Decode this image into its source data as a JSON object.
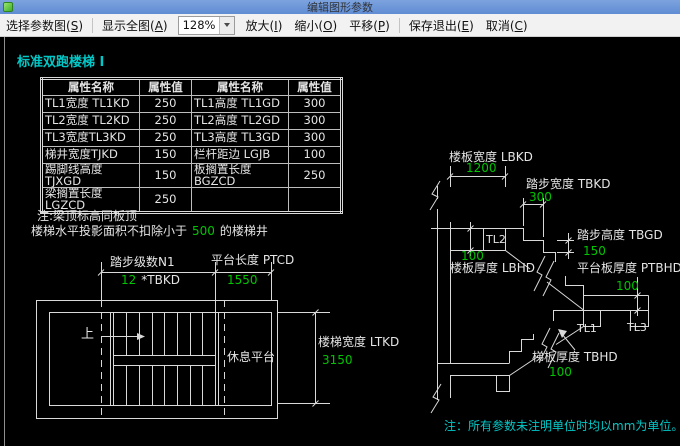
{
  "window": {
    "title": "编辑图形参数"
  },
  "toolbar": {
    "select_param": "选择参数图(S)",
    "show_all": "显示全图(A)",
    "zoom_value": "128%",
    "zoom_in": "放大(I)",
    "zoom_out": "缩小(O)",
    "pan": "平移(P)",
    "save_exit": "保存退出(E)",
    "cancel": "取消(C)"
  },
  "drawing": {
    "heading": "标准双跑楼梯 I",
    "table": {
      "headers": [
        "属性名称",
        "属性值",
        "属性名称",
        "属性值"
      ],
      "rows": [
        {
          "n1": "TL1宽度 TL1KD",
          "v1": "250",
          "n2": "TL1高度 TL1GD",
          "v2": "300"
        },
        {
          "n1": "TL2宽度 TL2KD",
          "v1": "250",
          "n2": "TL2高度 TL2GD",
          "v2": "300"
        },
        {
          "n1": "TL3宽度TL3KD",
          "v1": "250",
          "n2": "TL3高度 TL3GD",
          "v2": "300"
        },
        {
          "n1": "梯井宽度TJKD",
          "v1": "150",
          "n2": "栏杆距边 LGJB",
          "v2": "100"
        },
        {
          "n1": "踢脚线高度TJXGD",
          "v1": "150",
          "n2": "板搁置长度 BGZCD",
          "v2": "250"
        },
        {
          "n1": "梁搁置长度 LGZCD",
          "v1": "250",
          "n2": "",
          "v2": ""
        }
      ]
    },
    "notes": {
      "line1": "注:梁顶标高同板顶",
      "line2_pre": "楼梯水平投影面积不扣除小于",
      "line2_value": "500",
      "line2_post": "的楼梯井"
    },
    "plan": {
      "steps_label": "踏步级数N1",
      "steps_value": "12",
      "steps_unit": "*TBKD",
      "platform_label": "平台长度 PTCD",
      "platform_value": "1550",
      "up": "上",
      "rest_platform": "休息平台",
      "width_label": "楼梯宽度 LTKD",
      "width_value": "3150"
    },
    "section": {
      "lbkd_label": "楼板宽度 LBKD",
      "lbkd_value": "1200",
      "tbkd_label": "踏步宽度 TBKD",
      "tbkd_value": "300",
      "tbgd_label": "踏步高度 TBGD",
      "tbgd_value": "150",
      "lbhd_label": "楼板厚度 LBHD",
      "lbhd_value": "100",
      "ptbhd_label": "平台板厚度 PTBHD",
      "ptbhd_value": "100",
      "tbhd_label": "梯板厚度 TBHD",
      "tbhd_value": "100",
      "tl1": "TL1",
      "tl2": "TL2",
      "tl3": "TL3"
    },
    "unit_note": "注：所有参数未注明单位时均以mm为单位。"
  },
  "colors": {
    "value_green": "#00c400",
    "heading_cyan": "#00c8c8",
    "line": "#d9d9d9"
  }
}
